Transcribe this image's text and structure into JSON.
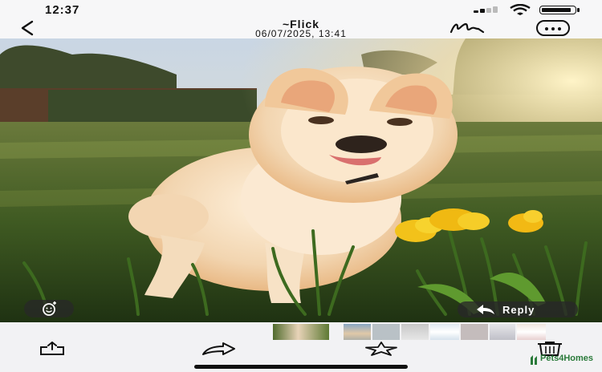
{
  "status_bar": {
    "time": "12:37",
    "icons": [
      "cellular-signal-icon",
      "wifi-icon",
      "battery-icon"
    ]
  },
  "nav_bar": {
    "back_icon": "chevron-left-icon",
    "sender": "~Flick",
    "timestamp": "06/07/2025, 13:41",
    "markup_icon": "markup-signature-icon",
    "more_icon": "ellipsis-circle-icon"
  },
  "photo": {
    "description_icon": "photo-of-dog"
  },
  "overlay": {
    "tapback_icon": "add-reaction-icon",
    "reply_icon": "reply-arrow-icon",
    "reply_label": "Reply"
  },
  "thumbnails": {
    "count": 8,
    "selected_index": 0
  },
  "toolbar": {
    "share_icon": "share-icon",
    "forward_icon": "forward-arrow-icon",
    "star_icon": "star-icon",
    "trash_icon": "trash-icon"
  },
  "watermark": {
    "text": "Pets4Homes"
  },
  "colors": {
    "bar_background": "#f2f2f4",
    "overlay_pill": "#2a2a2a",
    "watermark_green": "#2a7a3a"
  }
}
